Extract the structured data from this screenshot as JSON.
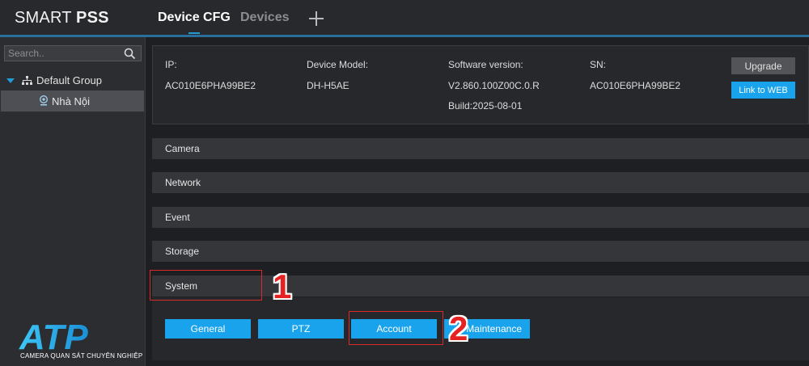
{
  "header": {
    "logo_regular": "SMART ",
    "logo_bold": "PSS",
    "tabs": [
      {
        "label": "Device CFG",
        "active": true
      },
      {
        "label": "Devices",
        "active": false
      }
    ],
    "add_tab_icon": "plus-icon",
    "accent_color": "#1e9dd8"
  },
  "sidebar": {
    "search_placeholder": "Search..",
    "group_label": "Default Group",
    "device_label": "Nhà Nội"
  },
  "watermark": {
    "logo_text": "ATP",
    "tagline": "CAMERA QUAN SÁT CHUYÊN NGHIỆP"
  },
  "device_info": {
    "ip_label": "IP:",
    "ip_value": "AC010E6PHA99BE2",
    "model_label": "Device Model:",
    "model_value": "DH-H5AE",
    "software_label": "Software version:",
    "software_value": "V2.860.100Z00C.0.R",
    "build_value": "Build:2025-08-01",
    "sn_label": "SN:",
    "sn_value": "AC010E6PHA99BE2",
    "upgrade_label": "Upgrade",
    "web_label": "Link to WEB"
  },
  "sections": [
    "Camera",
    "Network",
    "Event",
    "Storage",
    "System"
  ],
  "system_buttons": [
    "General",
    "PTZ",
    "Account",
    "Maintenance"
  ],
  "annotations": {
    "step1": "1",
    "step2": "2",
    "color": "#e52222"
  }
}
